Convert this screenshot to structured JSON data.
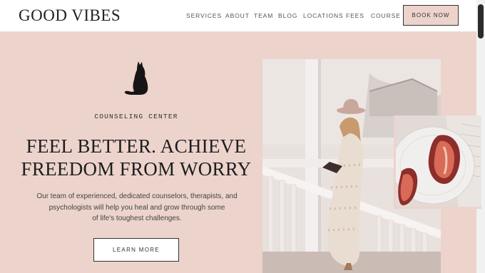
{
  "brand": {
    "logo_text": "GOOD VIBES"
  },
  "nav": {
    "items": [
      {
        "label": "SERVICES"
      },
      {
        "label": "ABOUT"
      },
      {
        "label": "TEAM"
      },
      {
        "label": "BLOG"
      },
      {
        "label": "LOCATIONS"
      },
      {
        "label": "FEES"
      },
      {
        "label": "COURSE"
      }
    ],
    "cta_label": "BOOK NOW"
  },
  "hero": {
    "eyebrow": "COUNSELING CENTER",
    "headline_line1": "FEEL BETTER. ACHIEVE",
    "headline_line2": "FREEDOM FROM WORRY",
    "body_line1": "Our team of experienced, dedicated counselors, therapists, and",
    "body_line2": "psychologists will help you heal and grow through some",
    "body_line3": "of life's toughest challenges.",
    "cta_label": "LEARN MORE"
  },
  "images": {
    "logo_mark": "cat-silhouette-icon",
    "main_photo": "woman-reading-on-porch",
    "secondary_photo": "sliced-figs-on-plate"
  },
  "colors": {
    "accent_pink": "#ecd3cc",
    "text_dark": "#1e1e1e",
    "header_bg": "#ffffff"
  }
}
